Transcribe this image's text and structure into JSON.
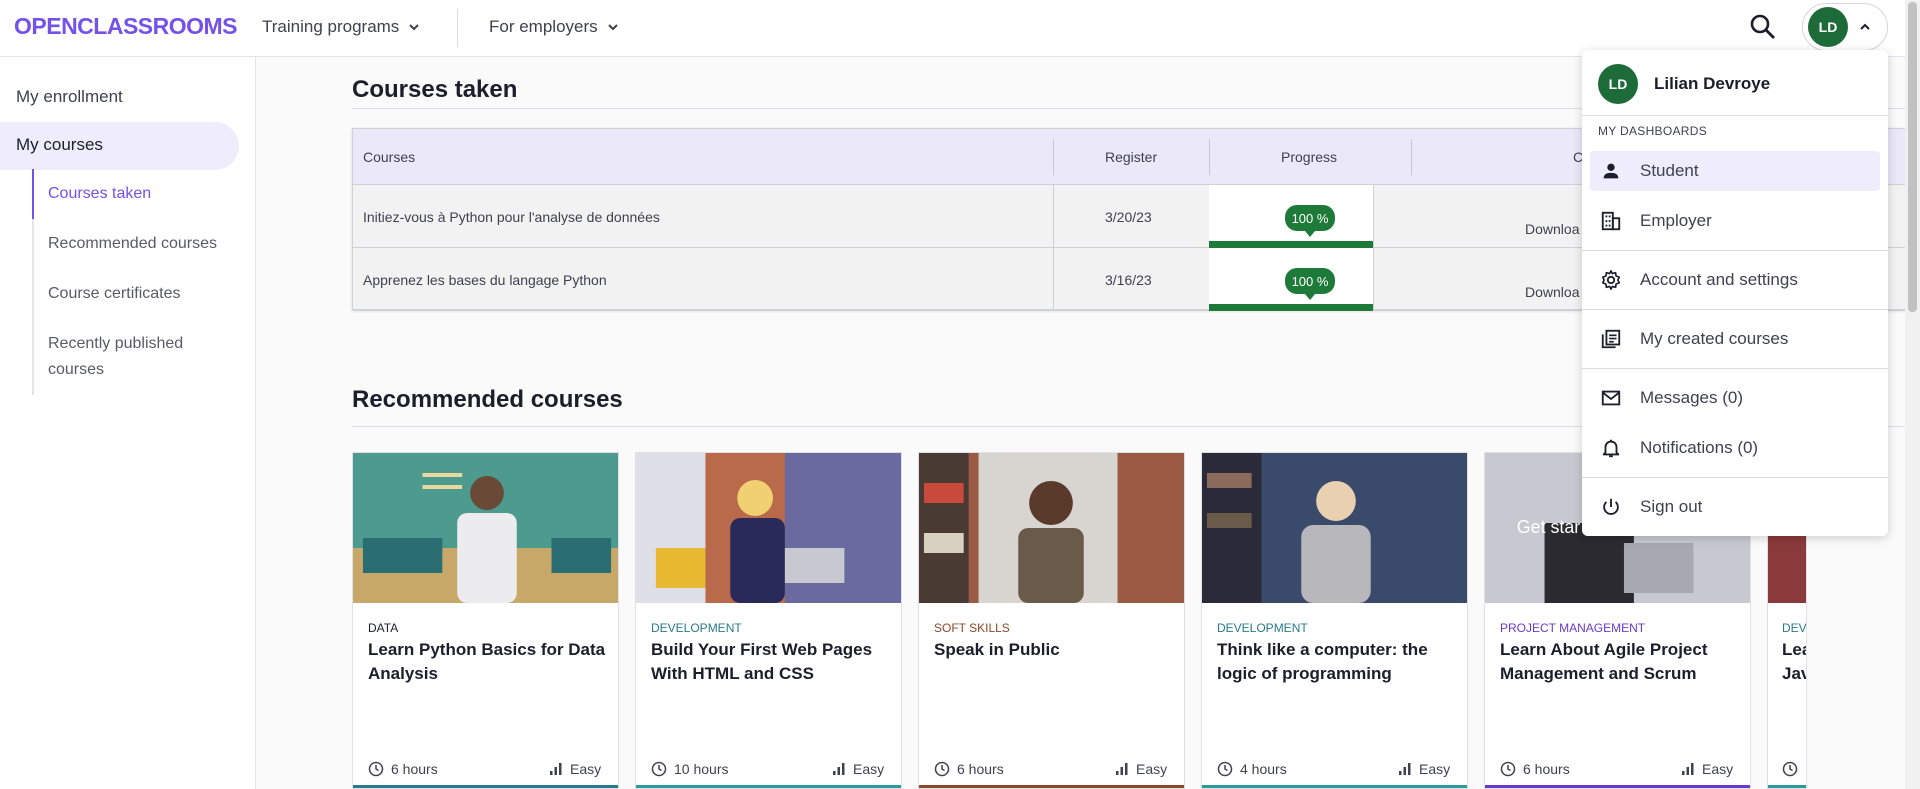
{
  "header": {
    "logo": "OPENCLASSROOMS",
    "nav": [
      {
        "label": "Training programs"
      },
      {
        "label": "For employers"
      }
    ],
    "user_initials": "LD"
  },
  "sidebar": {
    "items": [
      {
        "label": "My enrollment"
      },
      {
        "label": "My courses"
      }
    ],
    "sub_items": [
      {
        "label": "Courses taken"
      },
      {
        "label": "Recommended courses"
      },
      {
        "label": "Course certificates"
      },
      {
        "label": "Recently published courses"
      }
    ]
  },
  "courses_taken": {
    "title": "Courses taken",
    "columns": [
      "Courses",
      "Register",
      "Progress",
      "Ce"
    ],
    "rows": [
      {
        "course": "Initiez-vous à Python pour l'analyse de données",
        "register": "3/20/23",
        "progress_label": "100 %",
        "progress": 1.0,
        "cert": "Downloa"
      },
      {
        "course": "Apprenez les bases du langage Python",
        "register": "3/16/23",
        "progress_label": "100 %",
        "progress": 1.0,
        "cert": "Downloa"
      }
    ]
  },
  "recommended": {
    "title": "Recommended courses",
    "cards": [
      {
        "category": "DATA",
        "category_color": "#1d1d2b",
        "title": "Learn Python Basics for Data Analysis",
        "duration": "6 hours",
        "level": "Easy",
        "bar_color": "#2a7a8c"
      },
      {
        "category": "DEVELOPMENT",
        "category_color": "#2a7a8c",
        "title": "Build Your First Web Pages With HTML and CSS",
        "duration": "10 hours",
        "level": "Easy",
        "bar_color": "#2a9a9c"
      },
      {
        "category": "SOFT SKILLS",
        "category_color": "#8a4a2a",
        "title": "Speak in Public",
        "duration": "6 hours",
        "level": "Easy",
        "bar_color": "#8a4a2a"
      },
      {
        "category": "DEVELOPMENT",
        "category_color": "#2a7a8c",
        "title": "Think like a computer: the logic of programming",
        "duration": "4 hours",
        "level": "Easy",
        "bar_color": "#2a9a9c"
      },
      {
        "category": "PROJECT MANAGEMENT",
        "category_color": "#6a3ad0",
        "title": "Learn About Agile Project Management and Scrum",
        "duration": "6 hours",
        "level": "Easy",
        "bar_color": "#6a3ad0",
        "overlay": "Get star"
      },
      {
        "category": "DEV",
        "category_color": "#2a7a8c",
        "title": "Lea Jav",
        "duration": "",
        "level": "",
        "bar_color": "#2a9a9c"
      }
    ]
  },
  "user_menu": {
    "initials": "LD",
    "name": "Lilian Devroye",
    "section_heading": "MY DASHBOARDS",
    "items": [
      {
        "label": "Student",
        "icon": "person-icon"
      },
      {
        "label": "Employer",
        "icon": "building-icon"
      },
      {
        "label": "Account and settings",
        "icon": "gear-icon"
      },
      {
        "label": "My created courses",
        "icon": "courses-icon"
      },
      {
        "label": "Messages (0)",
        "icon": "mail-icon"
      },
      {
        "label": "Notifications (0)",
        "icon": "bell-icon"
      },
      {
        "label": "Sign out",
        "icon": "power-icon"
      }
    ]
  },
  "colors": {
    "brand": "#7451eb",
    "success": "#1e7a38",
    "avatar": "#1e6b3a"
  }
}
